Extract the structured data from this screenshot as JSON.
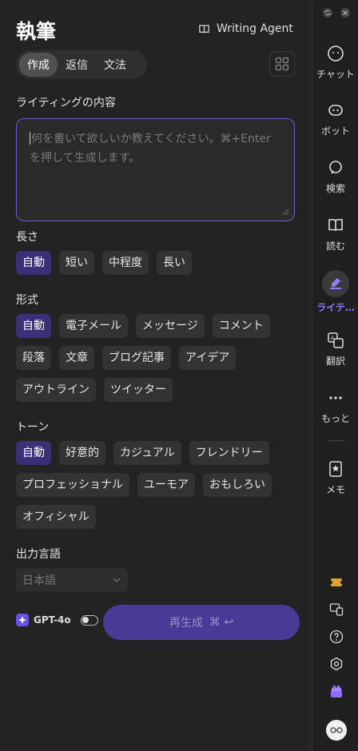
{
  "header": {
    "title": "執筆",
    "agent_label": "Writing Agent"
  },
  "tabs": [
    {
      "label": "作成",
      "active": true
    },
    {
      "label": "返信",
      "active": false
    },
    {
      "label": "文法",
      "active": false
    }
  ],
  "content": {
    "label": "ライティングの内容",
    "placeholder": "何を書いて欲しいか教えてください。⌘+Enterを押して生成します。"
  },
  "length": {
    "label": "長さ",
    "options": [
      "自動",
      "短い",
      "中程度",
      "長い"
    ],
    "selected": "自動"
  },
  "format": {
    "label": "形式",
    "options": [
      "自動",
      "電子メール",
      "メッセージ",
      "コメント",
      "段落",
      "文章",
      "ブログ記事",
      "アイデア",
      "アウトライン",
      "ツイッター"
    ],
    "selected": "自動"
  },
  "tone": {
    "label": "トーン",
    "options": [
      "自動",
      "好意的",
      "カジュアル",
      "フレンドリー",
      "プロフェッショナル",
      "ユーモア",
      "おもしろい",
      "オフィシャル"
    ],
    "selected": "自動"
  },
  "output_language": {
    "label": "出力言語",
    "value": "日本語"
  },
  "model": {
    "name": "GPT-4o"
  },
  "regenerate": {
    "label": "再生成",
    "shortcut": "⌘ ↩"
  },
  "sidebar": {
    "items": [
      {
        "label": "チャット",
        "icon": "chat-icon"
      },
      {
        "label": "ボット",
        "icon": "bot-icon"
      },
      {
        "label": "検索",
        "icon": "search-icon"
      },
      {
        "label": "読む",
        "icon": "book-icon"
      },
      {
        "label": "ライテ…",
        "icon": "pen-icon",
        "active": true
      },
      {
        "label": "翻訳",
        "icon": "translate-icon"
      },
      {
        "label": "もっと",
        "icon": "more-icon"
      },
      {
        "label": "メモ",
        "icon": "memo-icon"
      }
    ]
  },
  "colors": {
    "accent": "#6b5bd6",
    "selected_chip": "#3b2f79",
    "regen_button": "#4a3a96",
    "active_sidebar": "#8f7bff"
  }
}
